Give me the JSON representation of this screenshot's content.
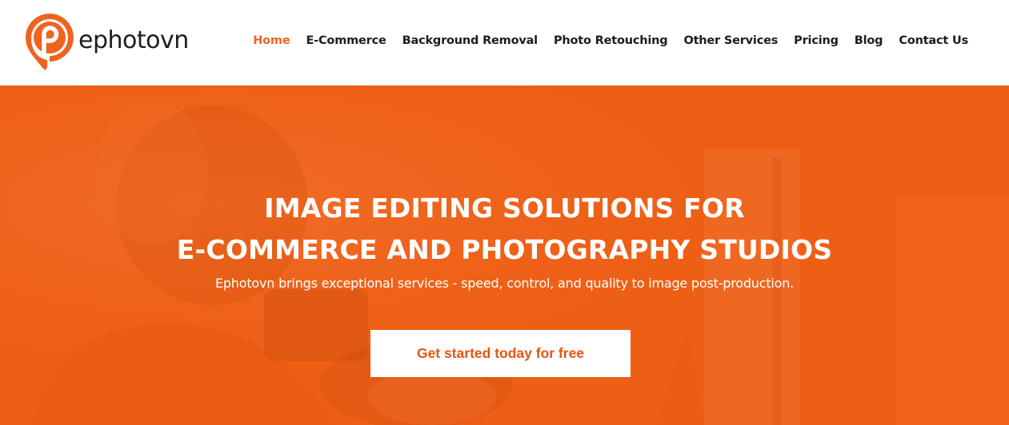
{
  "brand": {
    "name": "ephotovn",
    "logo_icon": "pin-logo-icon",
    "accent_color": "#ef6320"
  },
  "nav": {
    "items": [
      {
        "label": "Home",
        "active": true
      },
      {
        "label": "E-Commerce"
      },
      {
        "label": "Background Removal"
      },
      {
        "label": "Photo Retouching"
      },
      {
        "label": "Other Services"
      },
      {
        "label": "Pricing"
      },
      {
        "label": "Blog"
      },
      {
        "label": "Contact Us"
      }
    ]
  },
  "hero": {
    "title_line1": "IMAGE EDITING SOLUTIONS FOR",
    "title_line2": "E-COMMERCE AND PHOTOGRAPHY STUDIOS",
    "subtitle": "Ephotovn brings exceptional services - speed, control, and quality to image post-production.",
    "cta_label": "Get started today for free",
    "background_color": "#ee5f16"
  }
}
